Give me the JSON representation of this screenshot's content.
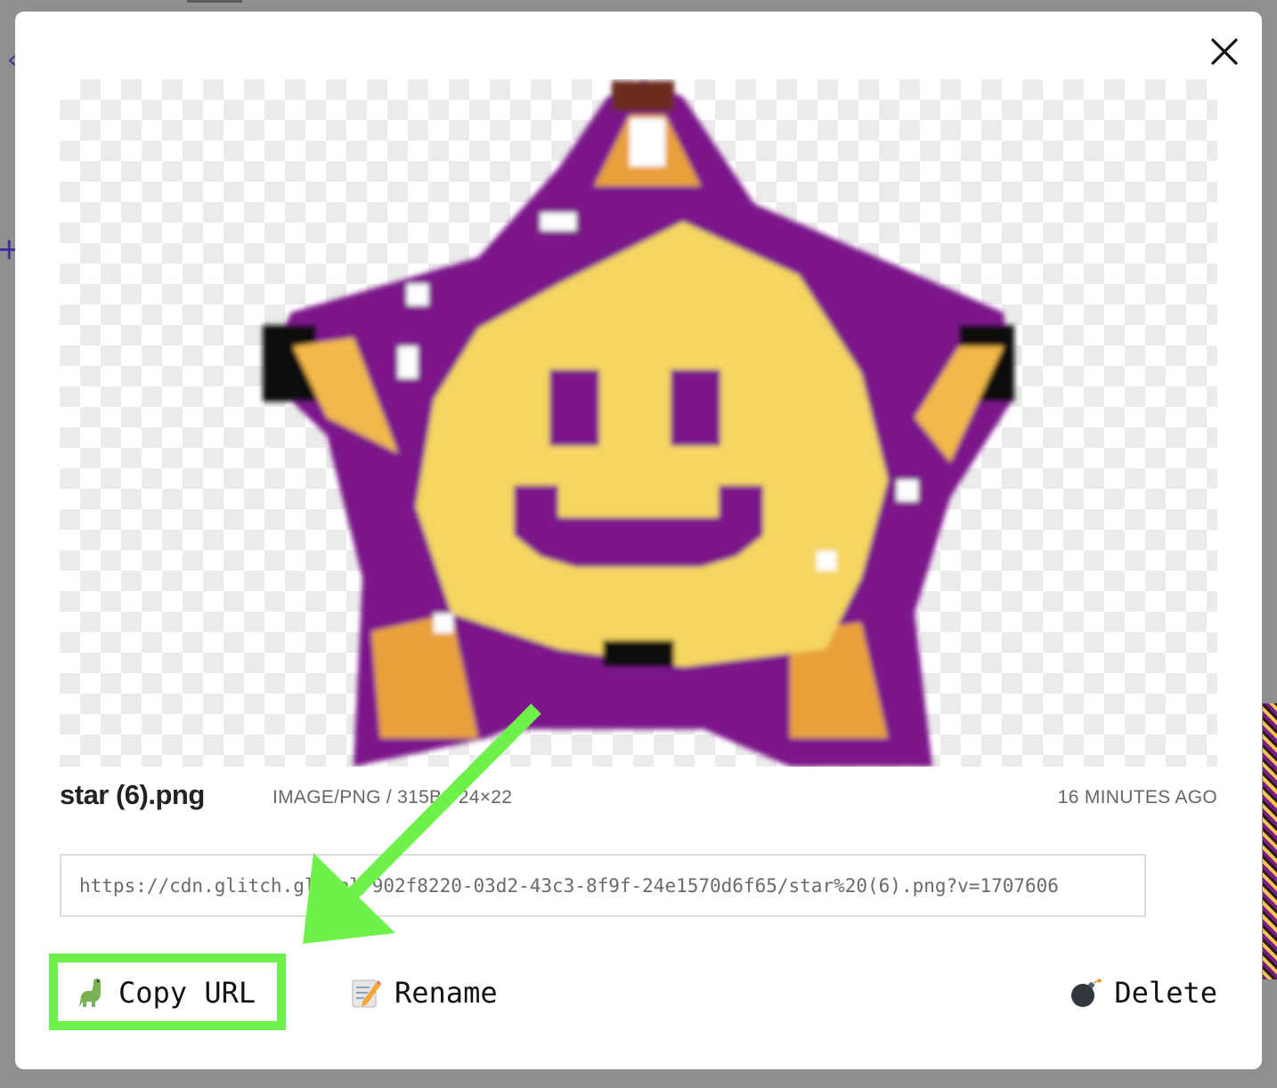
{
  "file": {
    "name": "star (6).png",
    "meta": "IMAGE/PNG / 315B / 24×22",
    "time": "16 MINUTES AGO",
    "url": "https://cdn.glitch.global/902f8220-03d2-43c3-8f9f-24e1570d6f65/star%20(6).png?v=1707606"
  },
  "actions": {
    "copy_label": "Copy URL",
    "copy_icon": "dinosaur-icon",
    "rename_label": "Rename",
    "rename_icon": "memo-icon",
    "delete_label": "Delete",
    "delete_icon": "bomb-icon"
  },
  "colors": {
    "highlight": "#6ef24a",
    "star_fill": "#f5d660",
    "star_outline": "#7b168a"
  }
}
